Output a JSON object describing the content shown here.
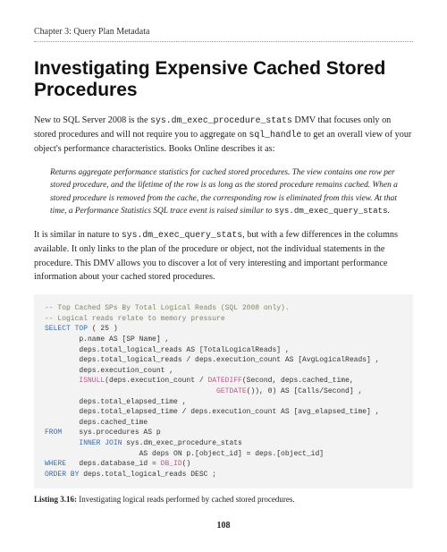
{
  "header": {
    "chapter": "Chapter 3: Query Plan Metadata"
  },
  "title": "Investigating Expensive Cached Stored Procedures",
  "intro": {
    "pre1": "New to SQL Server 2008 is the ",
    "code1": "sys.dm_exec_procedure_stats",
    "mid1": " DMV that focuses only on stored procedures and will not require you to aggregate on ",
    "code2": "sql_handle",
    "post1": " to get an overall view of your object's performance characteristics. Books Online describes it as:"
  },
  "quote": {
    "text1": "Returns aggregate performance statistics for cached stored procedures. The view contains one row per stored procedure, and the lifetime of the row is as long as the stored procedure remains cached. When a stored procedure is removed from the cache, the corresponding row is eliminated from this view. At that time, a Performance Statistics SQL trace event is raised similar to ",
    "qcode": "sys.dm_exec_query_stats",
    "text2": "."
  },
  "para2": {
    "pre": "It is similar in nature to ",
    "code": "sys.dm_exec_query_stats",
    "post": ", but with a few differences in the columns available. It only links to the plan of the procedure or object, not the individual statements in the procedure. This DMV allows you to discover a lot of very interesting and important performance information about your cached stored procedures."
  },
  "code": {
    "c1": "-- Top Cached SPs By Total Logical Reads (SQL 2008 only).",
    "c2": "-- Logical reads relate to memory pressure",
    "l1a": "SELECT TOP",
    "l1b": " ( 25 )",
    "l2": "        p.name AS [SP Name] ,",
    "l3": "        deps.total_logical_reads AS [TotalLogicalReads] ,",
    "l4": "        deps.total_logical_reads / deps.execution_count AS [AvgLogicalReads] ,",
    "l5": "        deps.execution_count ,",
    "l6a": "        ",
    "l6fn": "ISNULL",
    "l6b": "(deps.execution_count / ",
    "l6fn2": "DATEDIFF",
    "l6c": "(Second, deps.cached_time,",
    "l7a": "                                        ",
    "l7fn": "GETDATE",
    "l7b": "()), 0) AS [Calls/Second] ,",
    "l8": "        deps.total_elapsed_time ,",
    "l9": "        deps.total_elapsed_time / deps.execution_count AS [avg_elapsed_time] ,",
    "l10": "        deps.cached_time",
    "l11a": "FROM",
    "l11b": "    sys.procedures AS p",
    "l12a": "        INNER JOIN",
    "l12b": " sys.dm_exec_procedure_stats",
    "l13": "                      AS deps ON p.[object_id] = deps.[object_id]",
    "l14a": "WHERE",
    "l14b": "   deps.database_id = ",
    "l14fn": "DB_ID",
    "l14c": "()",
    "l15a": "ORDER BY",
    "l15b": " deps.total_logical_reads DESC ;"
  },
  "listing": {
    "label": "Listing 3.16:",
    "caption": "  Investigating logical reads performed by cached stored procedures."
  },
  "page": "108"
}
